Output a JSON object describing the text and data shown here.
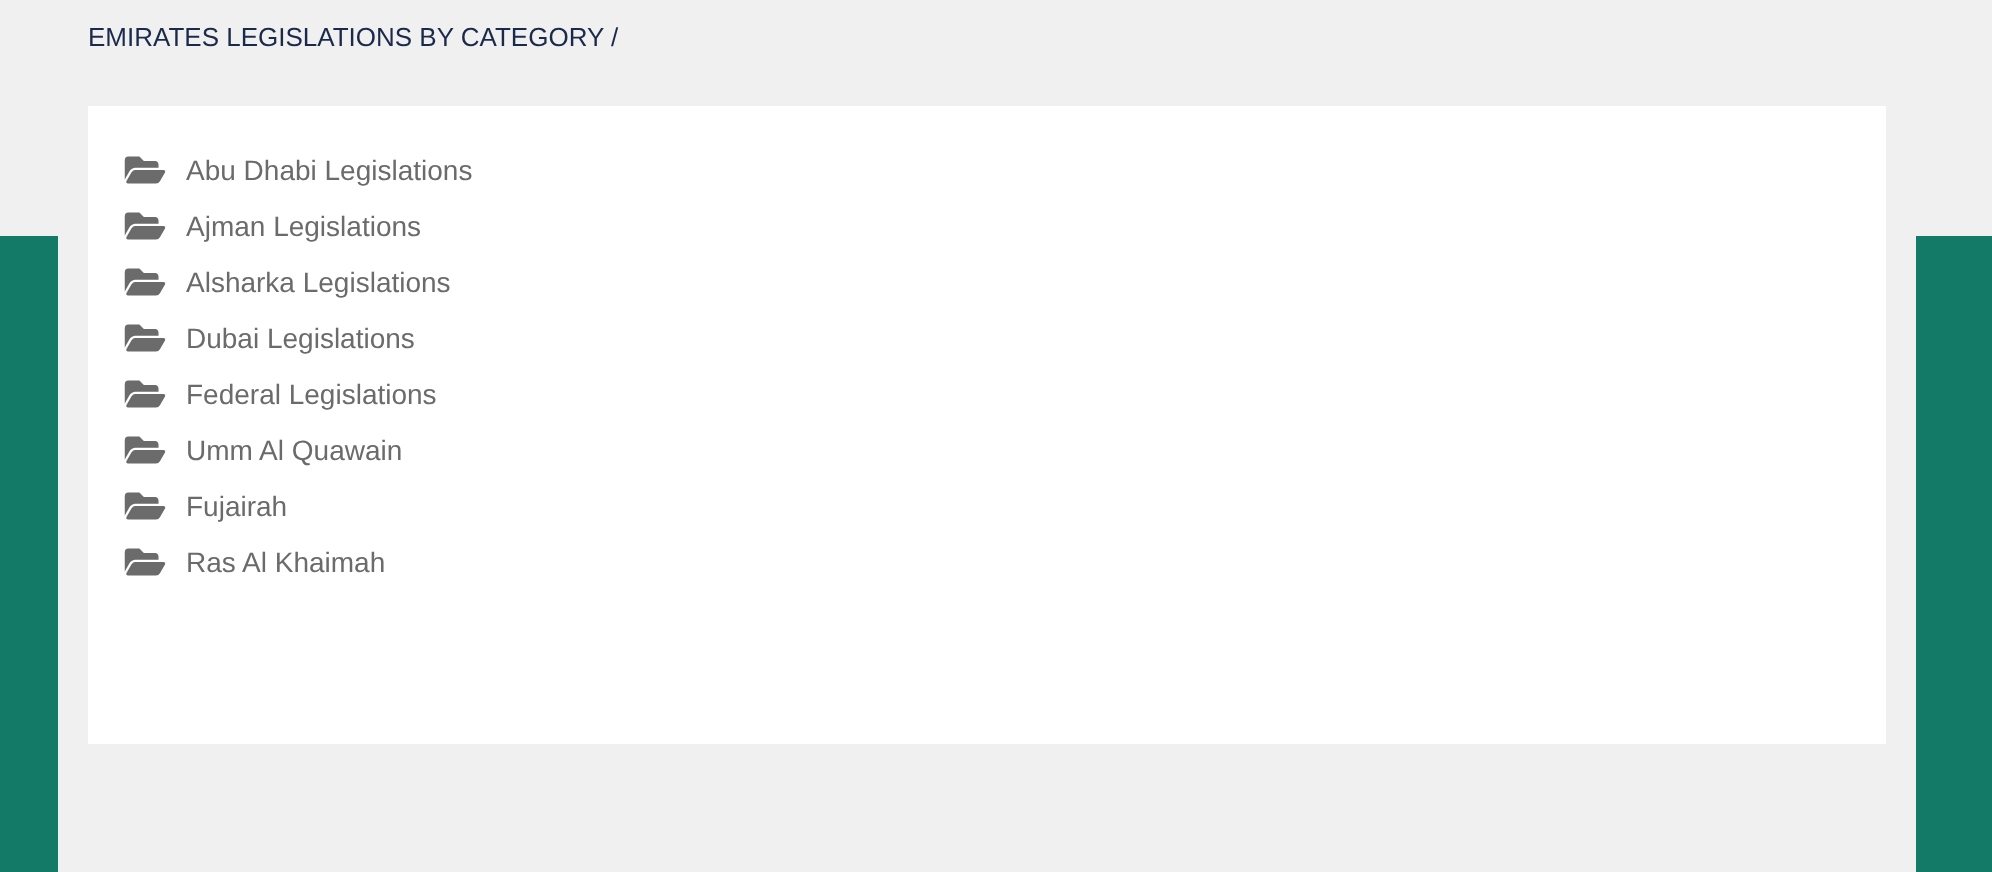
{
  "breadcrumb": "EMIRATES LEGISLATIONS BY CATEGORY /",
  "categories": [
    {
      "label": "Abu Dhabi Legislations"
    },
    {
      "label": "Ajman Legislations"
    },
    {
      "label": "Alsharka Legislations"
    },
    {
      "label": "Dubai Legislations"
    },
    {
      "label": "Federal Legislations"
    },
    {
      "label": "Umm Al Quawain"
    },
    {
      "label": "Fujairah"
    },
    {
      "label": "Ras Al Khaimah"
    }
  ]
}
